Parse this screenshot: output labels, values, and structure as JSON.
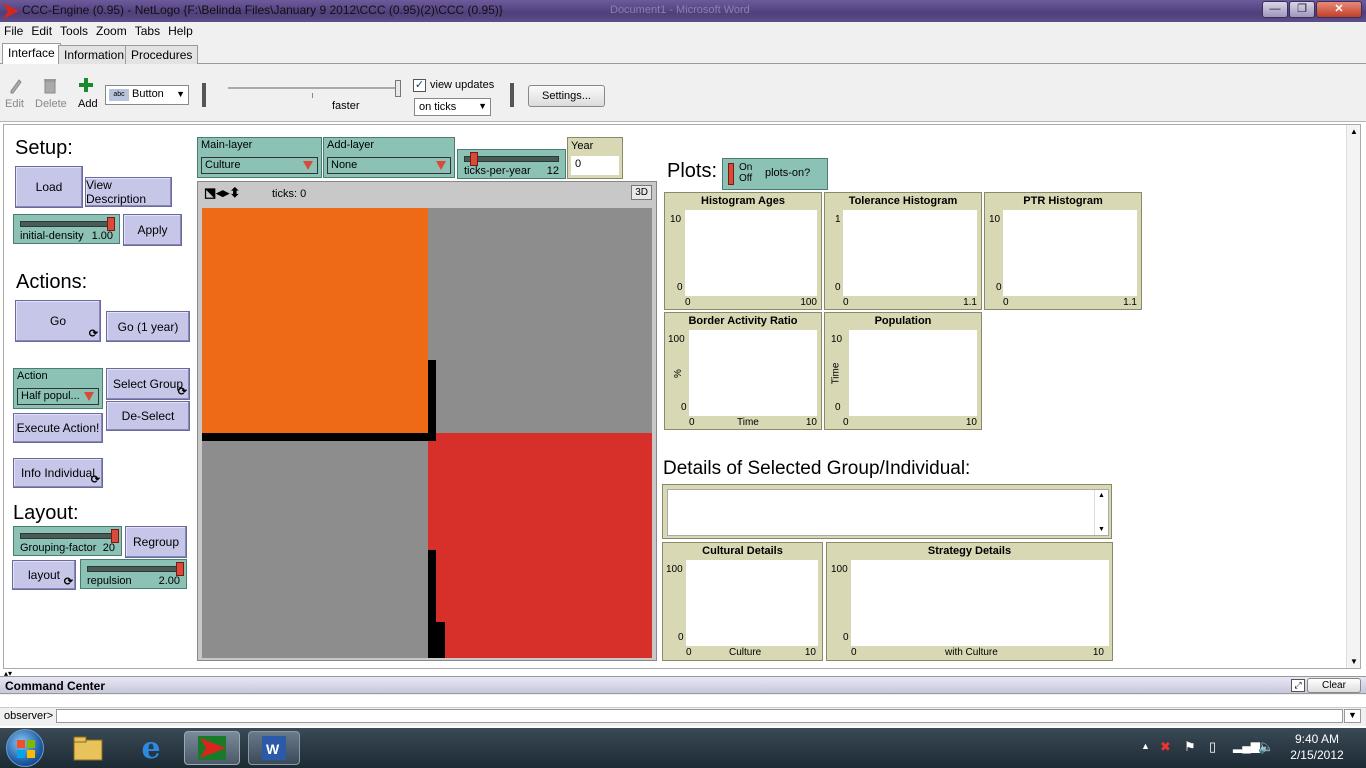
{
  "window": {
    "title": "CCC-Engine (0.95) - NetLogo {F:\\Belinda Files\\January 9 2012\\CCC (0.95)(2)\\CCC (0.95)}",
    "minimize": "—",
    "maximize": "❐",
    "close": "✕"
  },
  "menu": [
    "File",
    "Edit",
    "Tools",
    "Zoom",
    "Tabs",
    "Help"
  ],
  "tabs": [
    "Interface",
    "Information",
    "Procedures"
  ],
  "toolbar": {
    "edit": "Edit",
    "delete": "Delete",
    "add": "Add",
    "widget_type": "Button",
    "speed_label": "faster",
    "view_updates_label": "view updates",
    "view_updates_checked": true,
    "update_mode": "on ticks",
    "settings_label": "Settings..."
  },
  "setup": {
    "header": "Setup:",
    "load": "Load",
    "view_description": "View Description",
    "initial_density_label": "initial-density",
    "initial_density_value": "1.00",
    "apply": "Apply"
  },
  "actions": {
    "header": "Actions:",
    "go": "Go",
    "go_1year": "Go (1 year)",
    "action_label": "Action",
    "action_value": "Half popul...",
    "select_group": "Select Group",
    "deselect": "De-Select",
    "execute": "Execute Action!",
    "info_individual": "Info Individual"
  },
  "layout": {
    "header": "Layout:",
    "grouping_label": "Grouping-factor",
    "grouping_value": "20",
    "regroup": "Regroup",
    "layout_btn": "layout",
    "repulsion_label": "repulsion",
    "repulsion_value": "2.00"
  },
  "view_controls": {
    "main_layer_label": "Main-layer",
    "main_layer_value": "Culture",
    "add_layer_label": "Add-layer",
    "add_layer_value": "None",
    "ticks_per_year_label": "ticks-per-year",
    "ticks_per_year_value": "12",
    "year_label": "Year",
    "year_value": "0",
    "ticks_text": "ticks: 0",
    "three_d": "3D"
  },
  "world_colors": {
    "orange": "#ef6a16",
    "gray": "#8d8d8d",
    "red": "#d7302b",
    "black": "#000000"
  },
  "plots_section": {
    "header": "Plots:",
    "switch_on": "On",
    "switch_off": "Off",
    "switch_label": "plots-on?"
  },
  "plots": [
    {
      "title": "Histogram Ages",
      "ymax": "10",
      "ymin": "0",
      "xmin": "0",
      "xmax": "100",
      "xlabel": "",
      "ylabel": ""
    },
    {
      "title": "Tolerance Histogram",
      "ymax": "1",
      "ymin": "0",
      "xmin": "0",
      "xmax": "1.1",
      "xlabel": "",
      "ylabel": ""
    },
    {
      "title": "PTR Histogram",
      "ymax": "10",
      "ymin": "0",
      "xmin": "0",
      "xmax": "1.1",
      "xlabel": "",
      "ylabel": ""
    },
    {
      "title": "Border Activity Ratio",
      "ymax": "100",
      "ymin": "0",
      "xmin": "0",
      "xmax": "10",
      "xlabel": "Time",
      "ylabel": "%"
    },
    {
      "title": "Population",
      "ymax": "10",
      "ymin": "0",
      "xmin": "0",
      "xmax": "10",
      "xlabel": "",
      "ylabel": "Time"
    },
    {
      "title": "Cultural Details",
      "ymax": "100",
      "ymin": "0",
      "xmin": "0",
      "xmax": "10",
      "xlabel": "Culture",
      "ylabel": ""
    },
    {
      "title": "Strategy Details",
      "ymax": "100",
      "ymin": "0",
      "xmin": "0",
      "xmax": "10",
      "xlabel": "with Culture",
      "ylabel": ""
    }
  ],
  "details": {
    "header": "Details of Selected Group/Individual:"
  },
  "command_center": {
    "title": "Command Center",
    "clear": "Clear",
    "prompt": "observer>"
  },
  "taskbar": {
    "time": "9:40 AM",
    "date": "2/15/2012"
  }
}
